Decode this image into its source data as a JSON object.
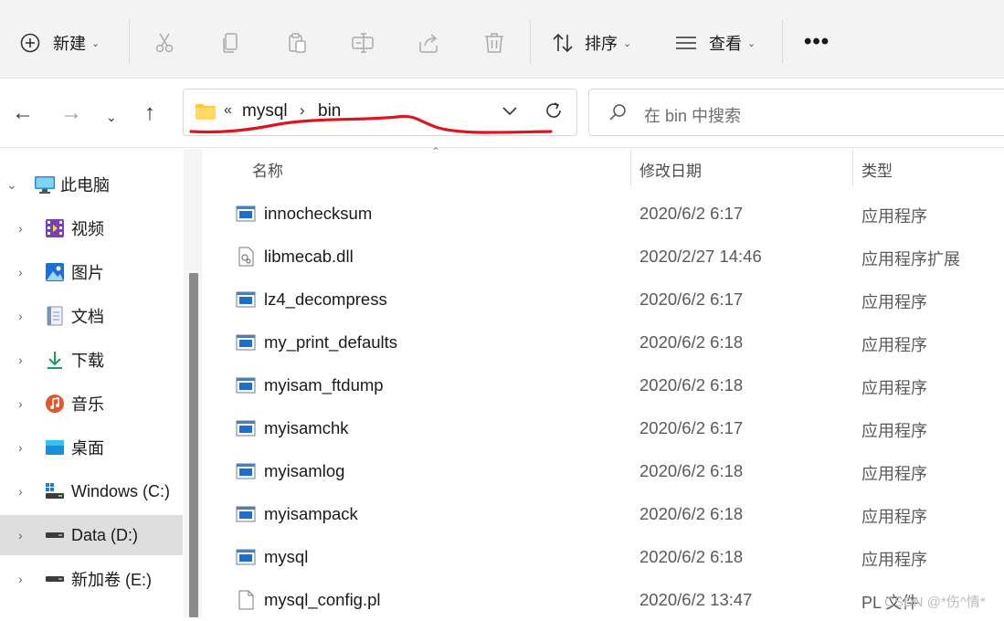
{
  "toolbar": {
    "new_label": "新建",
    "sort_label": "排序",
    "view_label": "查看",
    "more_label": "•••"
  },
  "address": {
    "overflow": "«",
    "crumbs": [
      "mysql",
      "bin"
    ],
    "separator": "›",
    "annotation_color": "#e0141e"
  },
  "search": {
    "placeholder": "在 bin 中搜索"
  },
  "sidebar": {
    "items": [
      {
        "label": "此电脑",
        "icon": "computer-icon"
      },
      {
        "label": "视频",
        "icon": "video-folder-icon"
      },
      {
        "label": "图片",
        "icon": "pictures-folder-icon"
      },
      {
        "label": "文档",
        "icon": "documents-folder-icon"
      },
      {
        "label": "下载",
        "icon": "download-folder-icon"
      },
      {
        "label": "音乐",
        "icon": "music-folder-icon"
      },
      {
        "label": "桌面",
        "icon": "desktop-folder-icon"
      },
      {
        "label": "Windows (C:)",
        "icon": "windows-drive-icon"
      },
      {
        "label": "Data (D:)",
        "icon": "drive-icon",
        "selected": true
      },
      {
        "label": "新加卷 (E:)",
        "icon": "drive-icon"
      }
    ]
  },
  "columns": {
    "name": "名称",
    "modified": "修改日期",
    "type": "类型"
  },
  "files": [
    {
      "name": "innochecksum",
      "date": "2020/6/2 6:17",
      "type": "应用程序",
      "icon": "application-icon"
    },
    {
      "name": "libmecab.dll",
      "date": "2020/2/27 14:46",
      "type": "应用程序扩展",
      "icon": "dll-file-icon"
    },
    {
      "name": "lz4_decompress",
      "date": "2020/6/2 6:17",
      "type": "应用程序",
      "icon": "application-icon"
    },
    {
      "name": "my_print_defaults",
      "date": "2020/6/2 6:18",
      "type": "应用程序",
      "icon": "application-icon"
    },
    {
      "name": "myisam_ftdump",
      "date": "2020/6/2 6:18",
      "type": "应用程序",
      "icon": "application-icon"
    },
    {
      "name": "myisamchk",
      "date": "2020/6/2 6:17",
      "type": "应用程序",
      "icon": "application-icon"
    },
    {
      "name": "myisamlog",
      "date": "2020/6/2 6:18",
      "type": "应用程序",
      "icon": "application-icon"
    },
    {
      "name": "myisampack",
      "date": "2020/6/2 6:18",
      "type": "应用程序",
      "icon": "application-icon"
    },
    {
      "name": "mysql",
      "date": "2020/6/2 6:18",
      "type": "应用程序",
      "icon": "application-icon"
    },
    {
      "name": "mysql_config.pl",
      "date": "2020/6/2 13:47",
      "type": "PL 文件",
      "icon": "text-file-icon"
    }
  ],
  "watermark": "CSDN @*伤^情*"
}
